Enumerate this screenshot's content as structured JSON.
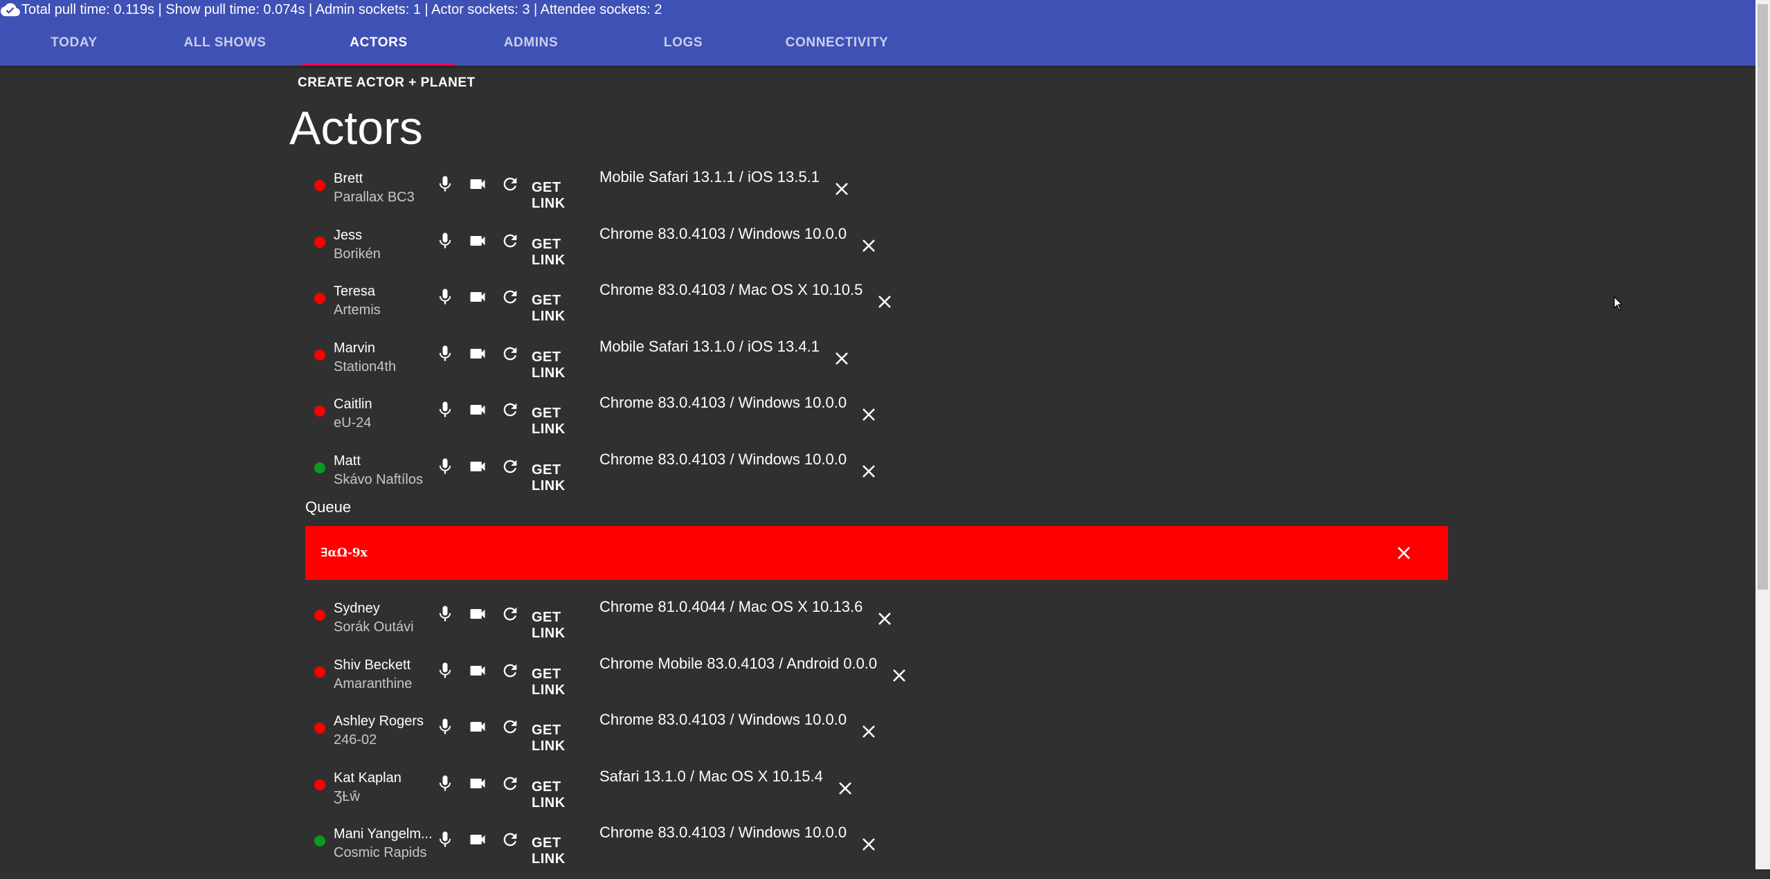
{
  "header": {
    "status_text": "Total pull time: 0.119s | Show pull time: 0.074s | Admin sockets: 1 | Actor sockets: 3 | Attendee sockets: 2",
    "status_icon": "cloud-done-icon",
    "tabs": [
      {
        "label": "TODAY",
        "active": false
      },
      {
        "label": "ALL SHOWS",
        "active": false
      },
      {
        "label": "ACTORS",
        "active": true
      },
      {
        "label": "ADMINS",
        "active": false
      },
      {
        "label": "LOGS",
        "active": false
      },
      {
        "label": "CONNECTIVITY",
        "active": false
      }
    ],
    "bar_color": "#3f51b5",
    "indicator_color": "#f50057"
  },
  "main": {
    "create_label": "CREATE ACTOR + PLANET",
    "title": "Actors",
    "get_link_label": "GET LINK",
    "queue_label": "Queue",
    "queue_item": {
      "name": "∃αΩ-9x",
      "color": "#ff0000"
    },
    "actors": [
      {
        "name": "Brett",
        "planet": "Parallax BC3",
        "status": "red",
        "client": "Mobile Safari 13.1.1 / iOS 13.5.1"
      },
      {
        "name": "Jess",
        "planet": "Borikén",
        "status": "red",
        "client": "Chrome 83.0.4103 / Windows 10.0.0"
      },
      {
        "name": "Teresa",
        "planet": "Artemis",
        "status": "red",
        "client": "Chrome 83.0.4103 / Mac OS X 10.10.5"
      },
      {
        "name": "Marvin",
        "planet": "Station4th",
        "status": "red",
        "client": "Mobile Safari 13.1.0 / iOS 13.4.1"
      },
      {
        "name": "Caitlin",
        "planet": "eU-24",
        "status": "red",
        "client": "Chrome 83.0.4103 / Windows 10.0.0"
      },
      {
        "name": "Matt",
        "planet": "Skávo Naftílos",
        "status": "green",
        "client": "Chrome 83.0.4103 / Windows 10.0.0"
      }
    ],
    "queued_actors": [
      {
        "name": "Sydney",
        "planet": "Sorák Outávi",
        "status": "red",
        "client": "Chrome 81.0.4044 / Mac OS X 10.13.6"
      },
      {
        "name": "Shiv Beckett",
        "planet": "Amaranthine",
        "status": "red",
        "client": "Chrome Mobile 83.0.4103 / Android 0.0.0"
      },
      {
        "name": "Ashley Rogers",
        "planet": "246-02",
        "status": "red",
        "client": "Chrome 83.0.4103 / Windows 10.0.0"
      },
      {
        "name": "Kat Kaplan",
        "planet": "ƷȽŵ",
        "status": "red",
        "client": "Safari 13.1.0 / Mac OS X 10.15.4"
      },
      {
        "name": "Mani Yangelm...",
        "planet": "Cosmic Rapids",
        "status": "green",
        "client": "Chrome 83.0.4103 / Windows 10.0.0"
      }
    ],
    "status_colors": {
      "red": "#ff0000",
      "green": "#089b1d"
    }
  }
}
